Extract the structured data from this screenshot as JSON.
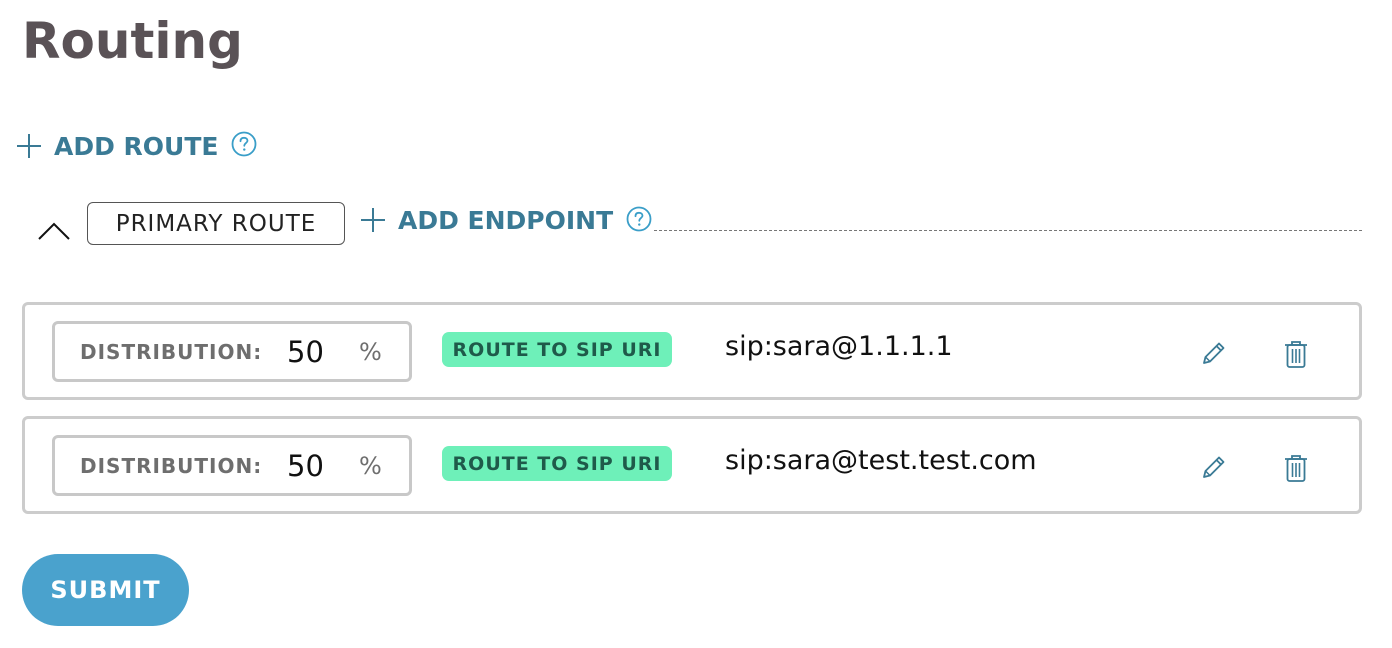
{
  "page": {
    "title": "Routing"
  },
  "actions": {
    "add_route_label": "ADD ROUTE",
    "add_endpoint_label": "ADD ENDPOINT",
    "submit_label": "SUBMIT"
  },
  "route": {
    "name": "PRIMARY ROUTE",
    "expanded": true
  },
  "endpoints": [
    {
      "distribution_label": "DISTRIBUTION:",
      "distribution_value": "50",
      "distribution_unit": "%",
      "route_type": "ROUTE TO SIP URI",
      "uri": "sip:sara@1.1.1.1"
    },
    {
      "distribution_label": "DISTRIBUTION:",
      "distribution_value": "50",
      "distribution_unit": "%",
      "route_type": "ROUTE TO SIP URI",
      "uri": "sip:sara@test.test.com"
    }
  ],
  "icons": {
    "add": "plus-icon",
    "help": "question-circle-icon",
    "collapse": "chevron-up-icon",
    "edit": "pencil-icon",
    "delete": "trash-icon"
  },
  "colors": {
    "title": "#5a5256",
    "link": "#3a7a95",
    "badge_bg": "#6ef0b9",
    "badge_text": "#1f5a4a",
    "submit_bg": "#4aa2cd",
    "card_border": "#cccccc"
  }
}
